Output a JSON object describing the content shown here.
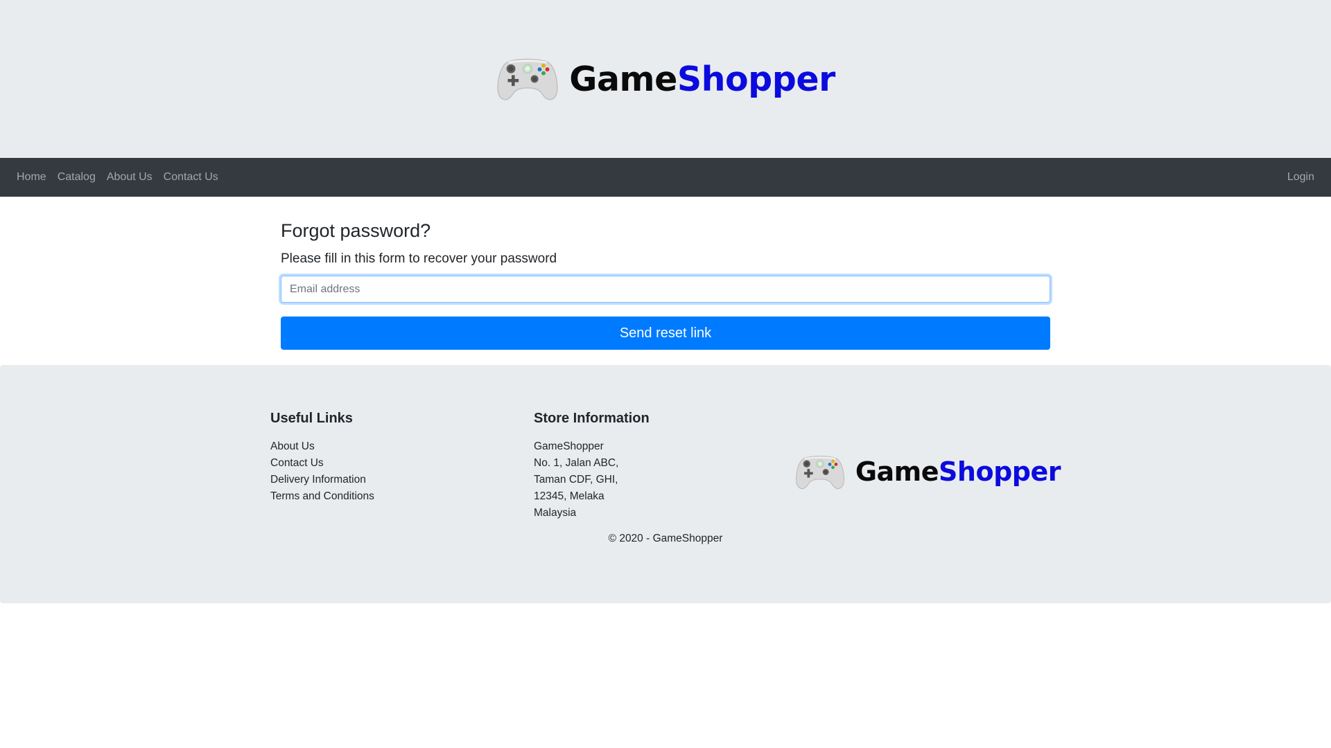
{
  "header": {
    "brand_part1": "Game",
    "brand_part2": "Shopper",
    "brand_color_dark": "#0a0a0a",
    "brand_color_accent": "#0b0bdd",
    "logo_icon": "gamepad-icon"
  },
  "navbar": {
    "items": [
      {
        "label": "Home"
      },
      {
        "label": "Catalog"
      },
      {
        "label": "About Us"
      },
      {
        "label": "Contact Us"
      }
    ],
    "login_label": "Login",
    "background": "#343a40"
  },
  "form": {
    "title": "Forgot password?",
    "subtitle": "Please fill in this form to recover your password",
    "email_placeholder": "Email address",
    "email_value": "",
    "submit_label": "Send reset link",
    "submit_color": "#007bff"
  },
  "footer": {
    "useful_links": {
      "title": "Useful Links",
      "links": [
        "About Us",
        "Contact Us",
        "Delivery Information",
        "Terms and Conditions"
      ]
    },
    "store_info": {
      "title": "Store Information",
      "lines": [
        "GameShopper",
        "No. 1, Jalan ABC,",
        "Taman CDF, GHI,",
        "12345, Melaka",
        "Malaysia"
      ]
    },
    "copyright": "© 2020 - GameShopper"
  }
}
